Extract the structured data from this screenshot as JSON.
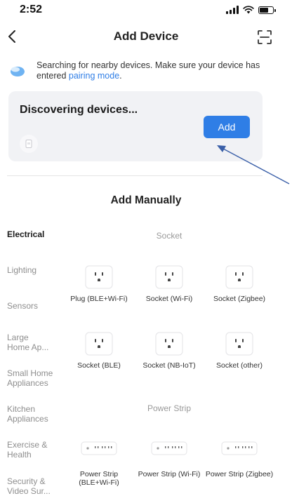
{
  "status": {
    "time": "2:52"
  },
  "nav": {
    "title": "Add Device",
    "back_icon": "chevron-left-icon",
    "scan_icon": "scan-icon"
  },
  "hint": {
    "text": "Searching for nearby devices. Make sure your device has entered ",
    "link": "pairing mode",
    "suffix": "."
  },
  "discover": {
    "title": "Discovering devices...",
    "add_label": "Add"
  },
  "manual": {
    "title": "Add Manually"
  },
  "categories": [
    "Electrical",
    "Lighting",
    "Sensors",
    "Large Home Ap...",
    "Small Home Appliances",
    "Kitchen Appliances",
    "Exercise & Health",
    "Security & Video Sur..."
  ],
  "groups": {
    "socket": {
      "title": "Socket",
      "items": [
        "Plug (BLE+Wi-Fi)",
        "Socket (Wi-Fi)",
        "Socket (Zigbee)",
        "Socket (BLE)",
        "Socket (NB-IoT)",
        "Socket (other)"
      ]
    },
    "power_strip": {
      "title": "Power Strip",
      "items": [
        "Power Strip (BLE+Wi-Fi)",
        "Power Strip (Wi-Fi)",
        "Power Strip (Zigbee)"
      ]
    }
  },
  "colors": {
    "accent": "#2f7ee6",
    "card_bg": "#f1f2f5",
    "annotation_arrow": "#3a5fa8"
  }
}
